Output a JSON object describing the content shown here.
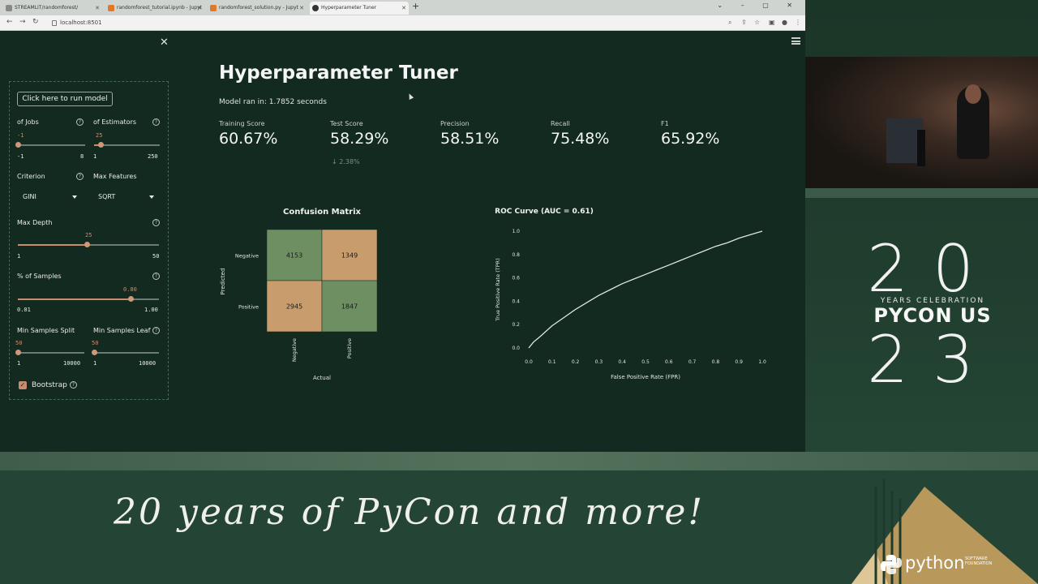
{
  "browser": {
    "tabs": [
      {
        "label": "STREAMLIT/randomforest/"
      },
      {
        "label": "randomforest_tutorial.ipynb - Jupyt"
      },
      {
        "label": "randomforest_solution.py - Jupyt"
      },
      {
        "label": "Hyperparameter Tuner"
      }
    ],
    "url": "localhost:8501"
  },
  "sidebar": {
    "run_button": "Click here to run model",
    "n_jobs": {
      "label": "of Jobs",
      "value": "-1",
      "min": "-1",
      "max": "8",
      "fraction": 0.0
    },
    "n_estimators": {
      "label": "of Estimators",
      "value": "25",
      "min": "1",
      "max": "250",
      "fraction": 0.1
    },
    "criterion": {
      "label": "Criterion",
      "value": "GINI"
    },
    "max_features": {
      "label": "Max Features",
      "value": "SQRT"
    },
    "max_depth": {
      "label": "Max Depth",
      "value": "25",
      "min": "1",
      "max": "50",
      "fraction": 0.49
    },
    "pct_samples": {
      "label": "% of Samples",
      "value": "0.80",
      "min": "0.01",
      "max": "1.00",
      "fraction": 0.8
    },
    "min_samples_split": {
      "label": "Min Samples Split",
      "value": "50",
      "min": "1",
      "max": "10000",
      "fraction": 0.005
    },
    "min_samples_leaf": {
      "label": "Min Samples Leaf",
      "value": "50",
      "min": "1",
      "max": "10000",
      "fraction": 0.005
    },
    "bootstrap": {
      "label": "Bootstrap",
      "checked": true
    }
  },
  "main": {
    "title": "Hyperparameter Tuner",
    "runtime": "Model ran in: 1.7852 seconds",
    "metrics": [
      {
        "label": "Training Score",
        "value": "60.67%"
      },
      {
        "label": "Test Score",
        "value": "58.29%"
      },
      {
        "label": "Precision",
        "value": "58.51%"
      },
      {
        "label": "Recall",
        "value": "75.48%"
      },
      {
        "label": "F1",
        "value": "65.92%"
      }
    ],
    "test_delta": "↓ 2.38%"
  },
  "chart_data": [
    {
      "type": "heatmap",
      "title": "Confusion Matrix",
      "xlabel": "Actual",
      "ylabel": "Predicted",
      "x_categories": [
        "Negative",
        "Positive"
      ],
      "y_categories": [
        "Negative",
        "Positive"
      ],
      "values": [
        [
          4153,
          1349
        ],
        [
          2945,
          1847
        ]
      ],
      "colors": {
        "high": "#c99c6e",
        "low": "#6e8f62"
      }
    },
    {
      "type": "line",
      "title": "ROC Curve (AUC = 0.61)",
      "xlabel": "False Positive Rate (FPR)",
      "ylabel": "True Positive Rate (TPR)",
      "xlim": [
        0,
        1
      ],
      "ylim": [
        0,
        1
      ],
      "xticks": [
        "0.0",
        "0.1",
        "0.2",
        "0.3",
        "0.4",
        "0.5",
        "0.6",
        "0.7",
        "0.8",
        "0.9",
        "1.0"
      ],
      "yticks": [
        "0.0",
        "0.2",
        "0.4",
        "0.6",
        "0.8",
        "1.0"
      ],
      "x": [
        0.0,
        0.02,
        0.05,
        0.1,
        0.15,
        0.2,
        0.25,
        0.3,
        0.35,
        0.4,
        0.45,
        0.5,
        0.55,
        0.6,
        0.65,
        0.7,
        0.75,
        0.8,
        0.85,
        0.9,
        0.95,
        1.0
      ],
      "y": [
        0.0,
        0.05,
        0.1,
        0.19,
        0.26,
        0.33,
        0.39,
        0.45,
        0.5,
        0.55,
        0.59,
        0.63,
        0.67,
        0.71,
        0.75,
        0.79,
        0.83,
        0.87,
        0.9,
        0.94,
        0.97,
        1.0
      ],
      "line_color": "#e0e8dc"
    }
  ],
  "branding": {
    "top_digits": "20",
    "years_text": "YEARS CELEBRATION",
    "pycon": "PYCON US",
    "bottom_digits": "23",
    "tagline": "20 years of PyCon and more!",
    "python_word": "python",
    "python_sub_1": "SOFTWARE",
    "python_sub_2": "FOUNDATION"
  },
  "colors": {
    "accent": "#c78d6e",
    "app_bg": "#132a20",
    "stage_bg": "#244535"
  }
}
